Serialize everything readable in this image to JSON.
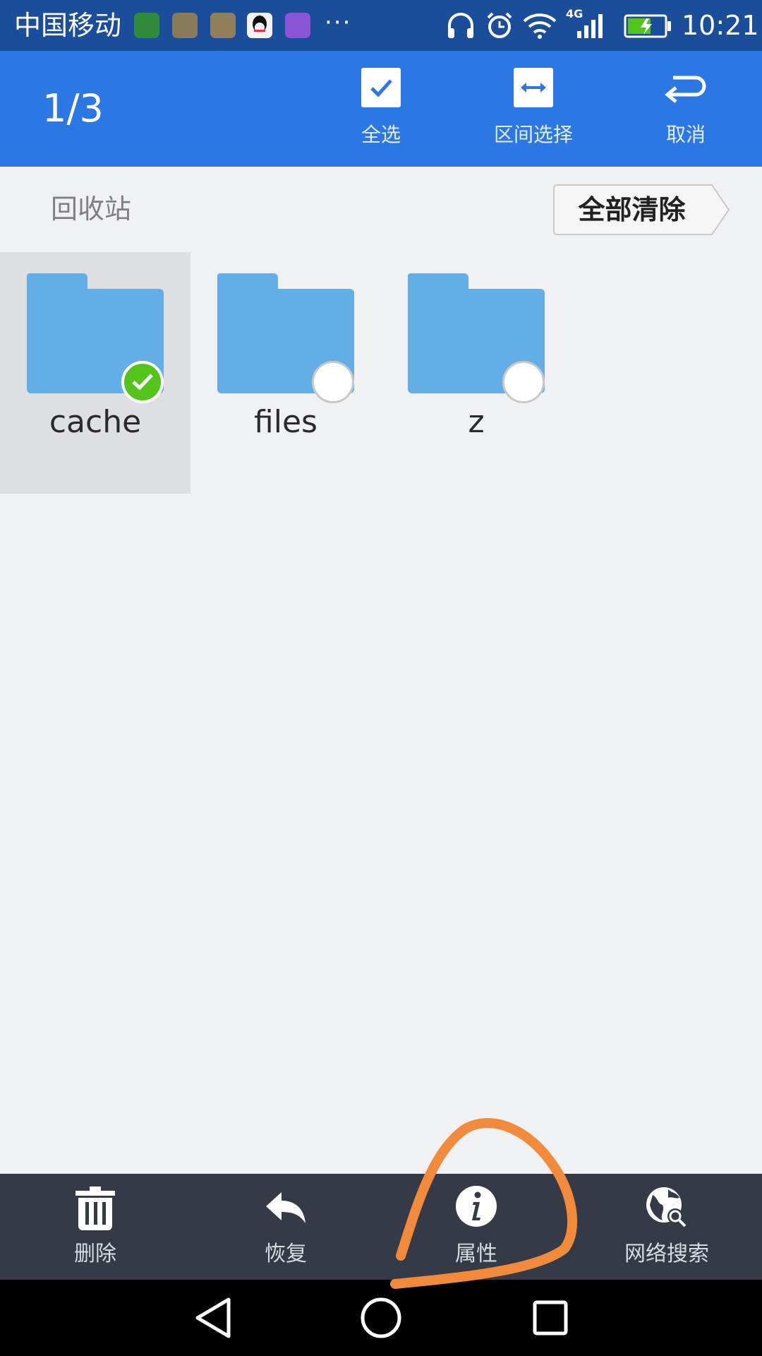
{
  "status_bar": {
    "carrier": "中国移动",
    "network": "4G",
    "time": "10:21",
    "more": "···"
  },
  "header": {
    "selection_count": "1/3",
    "actions": [
      {
        "label": "全选",
        "icon": "select-all-checkbox-icon"
      },
      {
        "label": "区间选择",
        "icon": "range-select-icon"
      },
      {
        "label": "取消",
        "icon": "cancel-return-icon"
      }
    ]
  },
  "breadcrumb": {
    "path": "回收站",
    "clear_all_label": "全部清除"
  },
  "files": [
    {
      "name": "cache",
      "selected": true
    },
    {
      "name": "files",
      "selected": false
    },
    {
      "name": "z",
      "selected": false
    }
  ],
  "bottom_actions": [
    {
      "label": "删除",
      "icon": "trash-icon"
    },
    {
      "label": "恢复",
      "icon": "restore-icon"
    },
    {
      "label": "属性",
      "icon": "info-icon"
    },
    {
      "label": "网络搜索",
      "icon": "globe-search-icon"
    }
  ],
  "colors": {
    "status_bar": "#1a4d9a",
    "header": "#2b78e4",
    "folder": "#64aee8",
    "selected_check": "#52c41a",
    "bottom_bar": "#343a46",
    "annotation": "#f28a3c"
  }
}
